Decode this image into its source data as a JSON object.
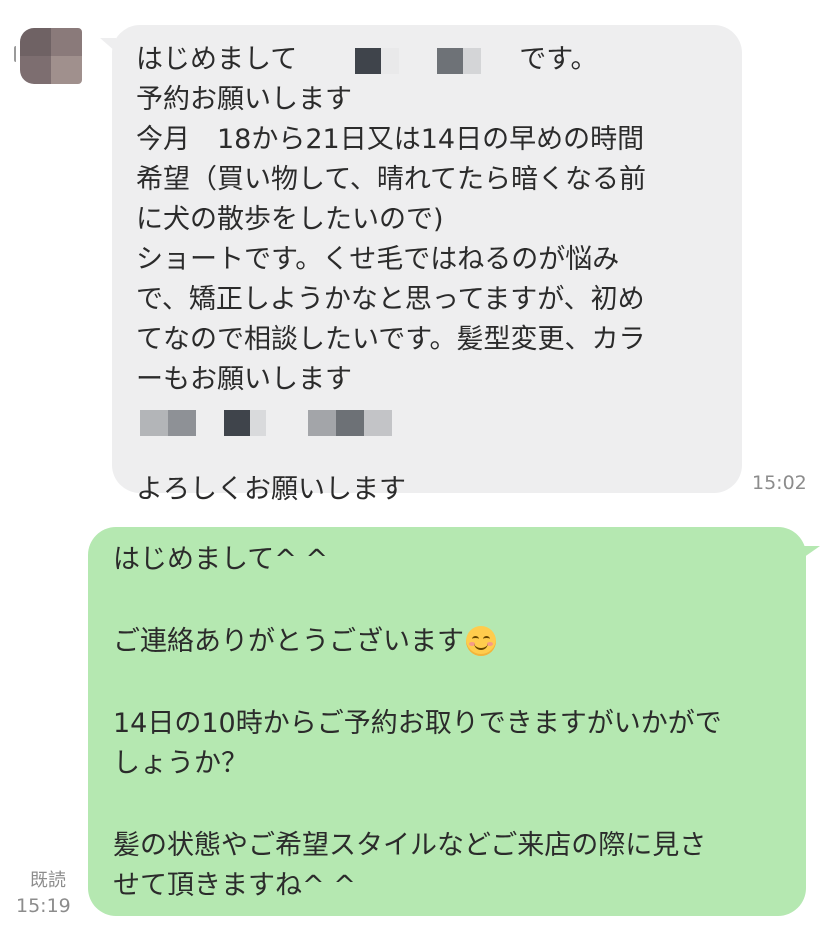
{
  "incoming": {
    "line1_start": "はじめまして",
    "line1_end": "です。",
    "line2": "予約お願いします",
    "line3": "今月　18から21日又は14日の早めの時間",
    "line4": "希望（買い物して、晴れてたら暗くなる前",
    "line5": "に犬の散歩をしたいので)",
    "line6": "ショートです。くせ毛ではねるのが悩み",
    "line7": "で、矯正しようかなと思ってますが、初め",
    "line8": "てなので相談したいです。髪型変更、カラ",
    "line9": "ーもお願いします",
    "line11": "よろしくお願いします",
    "time": "15:02"
  },
  "outgoing": {
    "line1": "はじめまして^ ^",
    "line2": "ご連絡ありがとうございます",
    "line3": "14日の10時からご予約お取りできますがいかがで",
    "line4": "しょうか？",
    "line5": "髪の状態やご希望スタイルなどご来店の際に見さ",
    "line6": "せて頂きますね^ ^",
    "emoji_icon": "smiling-face-emoji",
    "read_label": "既読",
    "time": "15:19"
  },
  "colors": {
    "incoming_bubble": "#eeeeef",
    "outgoing_bubble": "#b5e8b1",
    "timestamp": "#8c8c8c"
  }
}
